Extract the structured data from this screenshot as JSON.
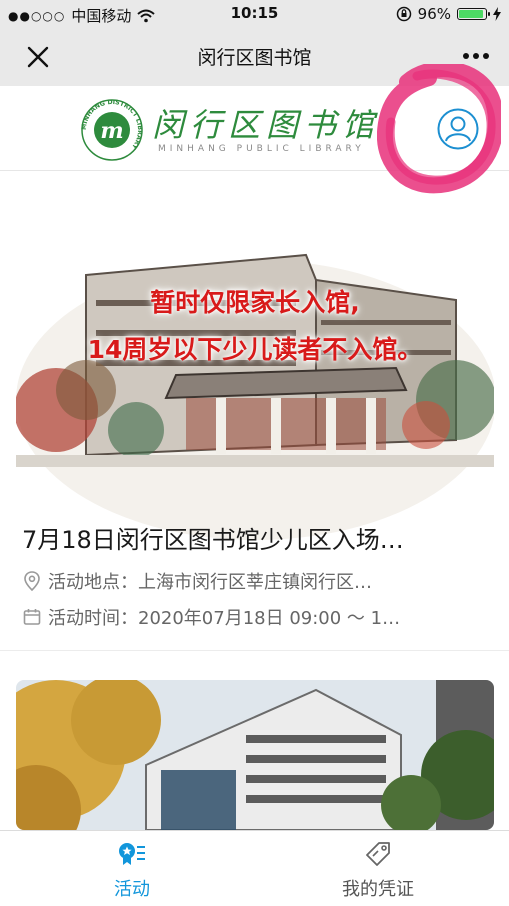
{
  "status": {
    "carrier": "中国移动",
    "time": "10:15",
    "battery": "96%",
    "battery_level": 0.96
  },
  "nav": {
    "title": "闵行区图书馆"
  },
  "brand": {
    "name_cn": "闵行区图书馆",
    "name_en": "MINHANG PUBLIC LIBRARY",
    "logo_ring_text": "MINHANG DISTRICT LIBRARY",
    "logo_letter": "m"
  },
  "card1": {
    "banner_line1": "暂时仅限家长入馆,",
    "banner_line2": "14周岁以下少儿读者不入馆。",
    "title": "7月18日闵行区图书馆少儿区入场…",
    "location": "活动地点：上海市闵行区莘庄镇闵行区…",
    "time": "活动时间：2020年07月18日 09:00 ～ 1…"
  },
  "tabs": [
    {
      "label": "活动",
      "icon": "activity-icon",
      "active": true
    },
    {
      "label": "我的凭证",
      "icon": "ticket-icon",
      "active": false
    }
  ],
  "colors": {
    "accent": "#1296db",
    "brand_green": "#2e8b3d",
    "highlight_pink": "#e8307a",
    "banner_red": "#d81a1a"
  }
}
